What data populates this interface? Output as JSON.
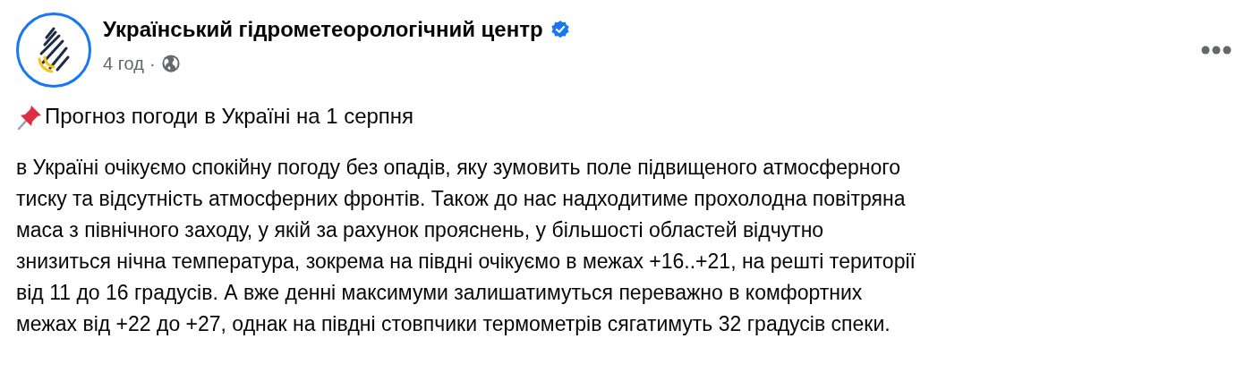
{
  "post": {
    "author": "Український гідрометеорологічний центр",
    "verified": true,
    "time": "4 год",
    "separator": "·",
    "heading": "Прогноз погоди в Україні на 1 серпня",
    "body_lines": [
      "в Україні очікуємо спокійну погоду без опадів, яку зумовить поле підвищеного атмосферного",
      "тиску та відсутність атмосферних фронтів. Також до нас надходитиме прохолодна повітряна",
      "маса з північного заходу, у якій за рахунок прояснень, у більшості областей відчутно",
      "знизиться нічна температура, зокрема на півдні очікуємо в межах +16..+21, на решті території",
      "від 11 до 16 градусів. А вже денні максимуми залишатимуться переважно в комфортних",
      "межах від +22 до +27, однак на півдні стовпчики термометрів сягатимуть 32 градусів спеки."
    ]
  }
}
